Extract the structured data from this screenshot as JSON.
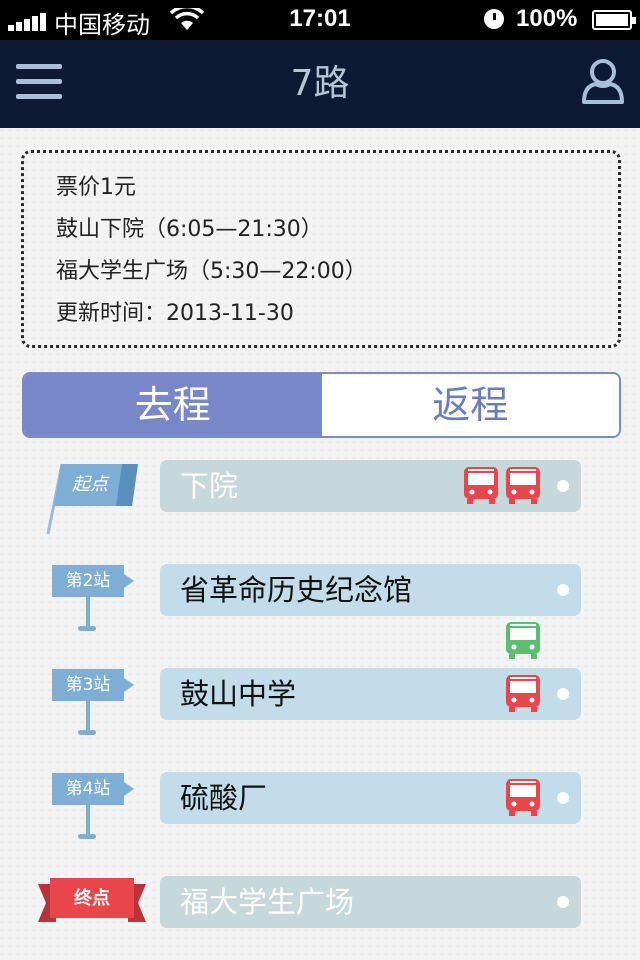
{
  "status_bar": {
    "carrier": "中国移动",
    "time": "17:01",
    "battery": "100%"
  },
  "nav": {
    "title": "7路",
    "menu_icon": "hamburger-menu-icon",
    "user_icon": "user-icon"
  },
  "info": {
    "fare": "票价1元",
    "line1": "鼓山下院（6:05—21:30）",
    "line2": "福大学生广场（5:30—22:00）",
    "updated": "更新时间：2013-11-30"
  },
  "tabs": {
    "outbound": "去程",
    "return": "返程",
    "active": "outbound"
  },
  "colors": {
    "bus_red": "#e8464a",
    "bus_green": "#5bbf72",
    "tab_active": "#7887c8",
    "station_tag": "#7eaed3",
    "end_badge": "#e8464a"
  },
  "stops": [
    {
      "badge": "起点",
      "name": "下院",
      "buses": 2,
      "kind": "start"
    },
    {
      "badge": "第2站",
      "name": "省革命历史纪念馆",
      "buses": 0,
      "kind": "mid"
    },
    {
      "badge": "第3站",
      "name": "鼓山中学",
      "buses": 1,
      "kind": "mid"
    },
    {
      "badge": "第4站",
      "name": "硫酸厂",
      "buses": 1,
      "kind": "mid"
    },
    {
      "badge": "终点",
      "name": "福大学生广场",
      "buses": 0,
      "kind": "end"
    }
  ],
  "in_transit": [
    {
      "between": "第2站-第3站",
      "color": "green"
    }
  ]
}
